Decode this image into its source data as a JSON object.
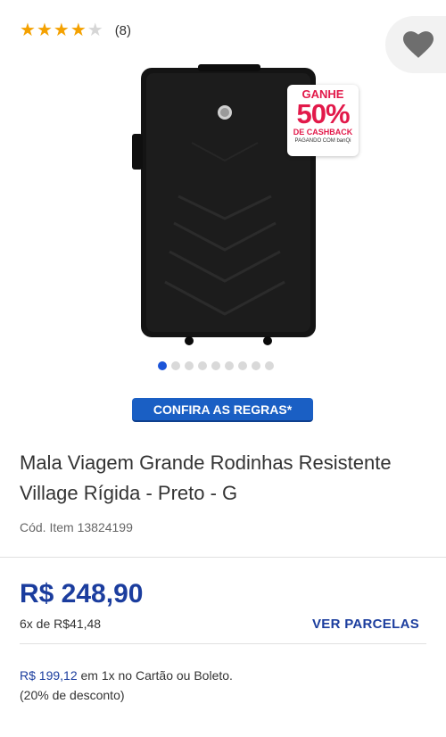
{
  "rating": {
    "stars_filled": 4,
    "stars_total": 5,
    "count_label": "(8)"
  },
  "favorite": {
    "icon": "heart-icon"
  },
  "badge": {
    "top": "GANHE",
    "percent": "50%",
    "mid": "DE CASHBACK",
    "bottom": "PAGANDO COM banQi"
  },
  "gallery": {
    "total": 9,
    "active": 1
  },
  "rules_button": {
    "label": "CONFIRA AS REGRAS*"
  },
  "product": {
    "title": "Mala Viagem Grande Rodinhas Resistente Village Rígida - Preto - G",
    "sku": "Cód. Item 13824199"
  },
  "pricing": {
    "price": "R$ 248,90",
    "installments": "6x de R$41,48",
    "see_installments": "VER PARCELAS",
    "cash_price": "R$ 199,12",
    "cash_text": "em 1x no Cartão ou Boleto.",
    "discount": "(20% de desconto)"
  },
  "colors": {
    "brand_blue": "#1b3d9e",
    "button_blue": "#1a5fc4",
    "star": "#f4a100",
    "cashback_red": "#e2194a"
  }
}
